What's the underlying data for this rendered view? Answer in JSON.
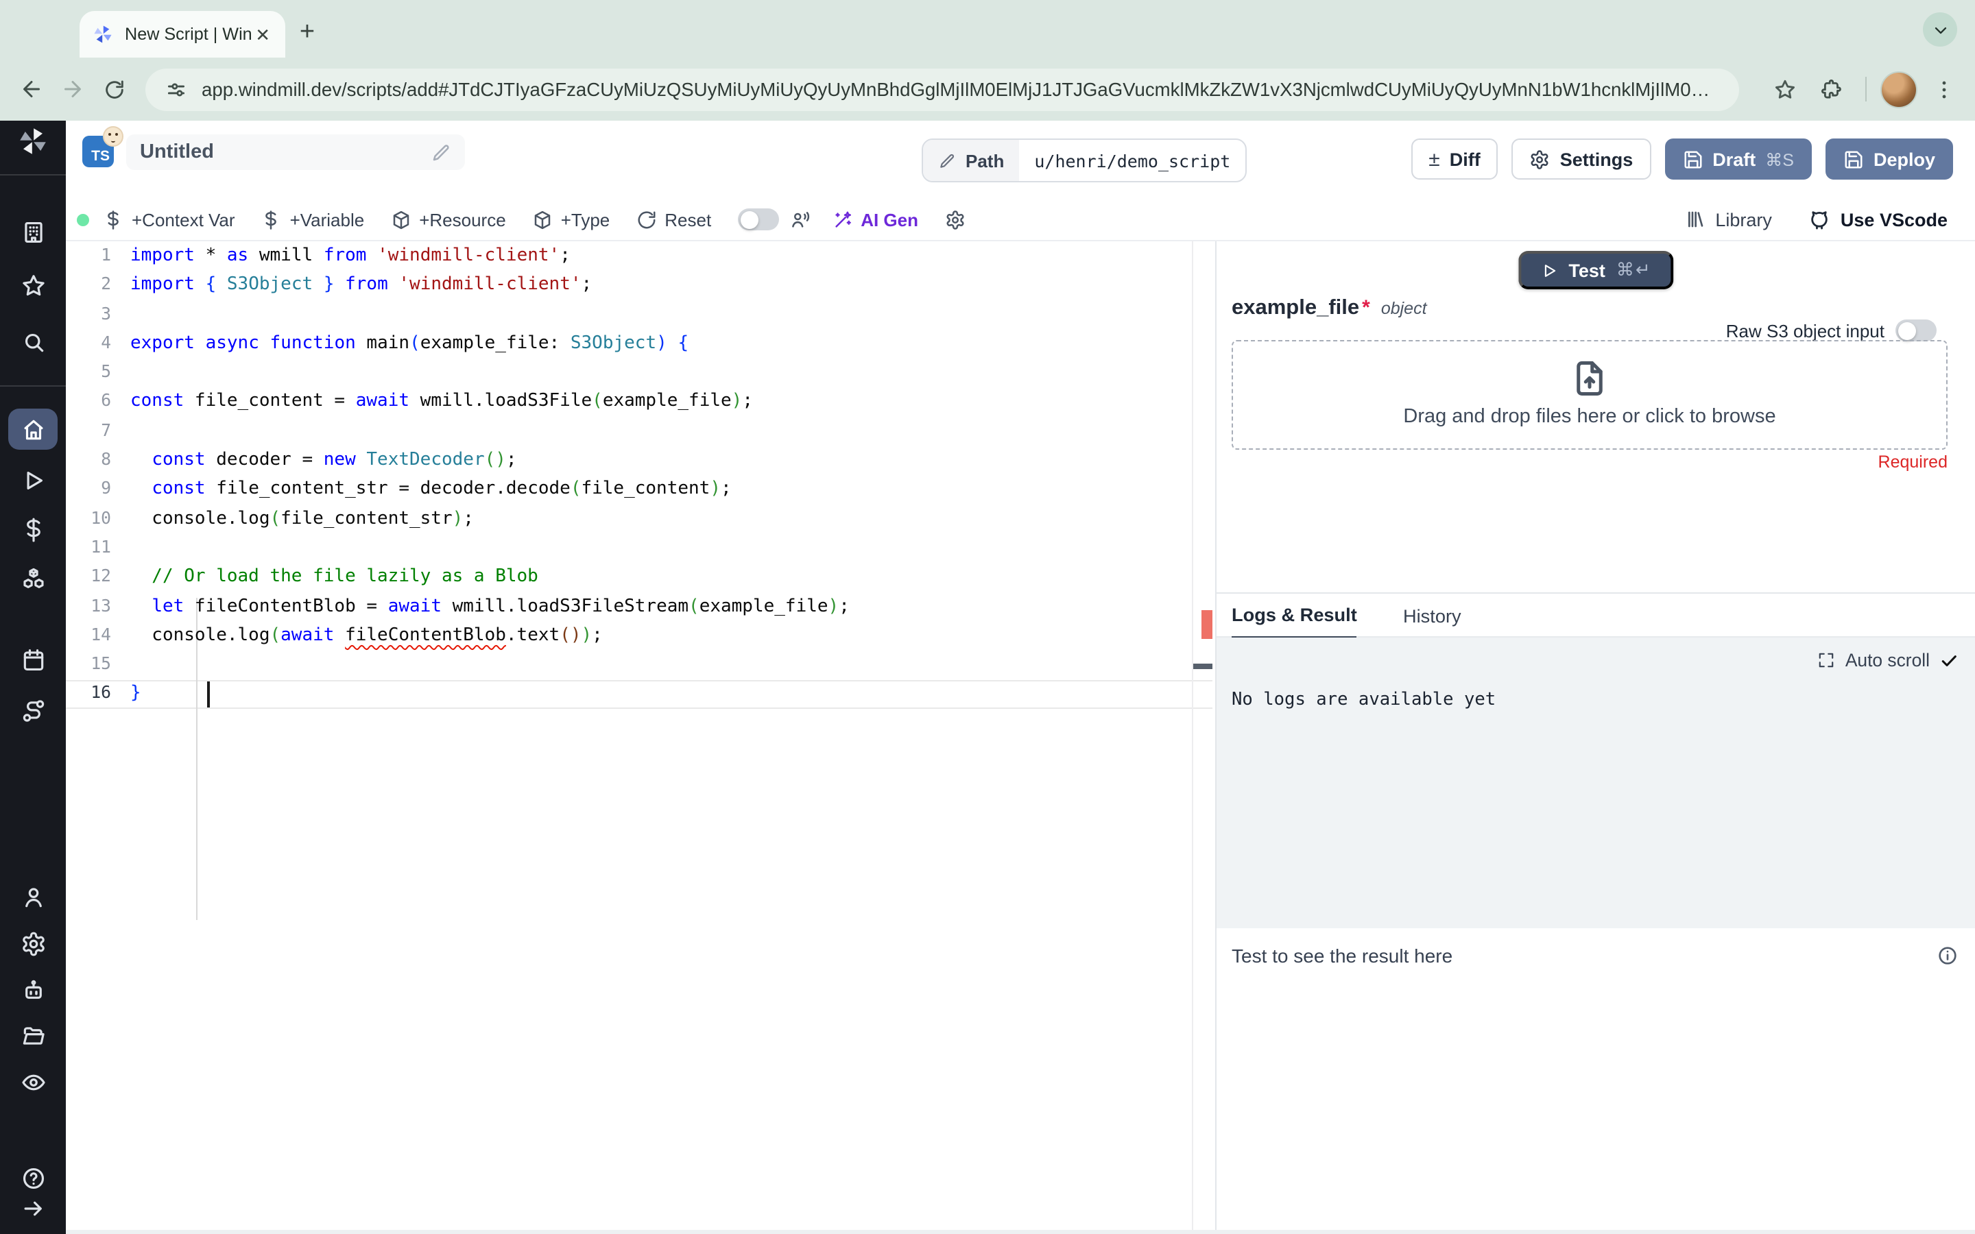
{
  "browser": {
    "tab_title": "New Script | Windmill",
    "url": "app.windmill.dev/scripts/add#JTdCJTIyaGFzaCUyMiUzQSUyMiUyMiUyQyUyMnBhdGglMjIlM0ElMjJ1JTJGaGVucmklMkZkZW1vX3NjcmlwdCUyMiUyQyUyMnN1bW1hcnklMjIlM0ElMjIlMjIlMkMlMjJjb250ZW50JTIyJTNBJTIy"
  },
  "header": {
    "language_badge": "TS",
    "title": "Untitled",
    "path_label": "Path",
    "path_value": "u/henri/demo_script",
    "diff_label": "Diff",
    "diff_symbol": "±",
    "settings_label": "Settings",
    "draft_label": "Draft",
    "draft_shortcut": "⌘S",
    "deploy_label": "Deploy"
  },
  "toolbar": {
    "items": [
      {
        "icon": "dollar",
        "label": "+Context Var"
      },
      {
        "icon": "dollar",
        "label": "+Variable"
      },
      {
        "icon": "package",
        "label": "+Resource"
      },
      {
        "icon": "package",
        "label": "+Type"
      },
      {
        "icon": "refresh",
        "label": "Reset"
      }
    ],
    "ai_gen_label": "AI Gen",
    "library_label": "Library",
    "vscode_label": "Use VScode"
  },
  "sidebar": {
    "sections": [
      {
        "items": [
          {
            "icon": "building"
          },
          {
            "icon": "star"
          },
          {
            "icon": "search"
          }
        ]
      },
      {
        "items": [
          {
            "icon": "home",
            "active": true
          },
          {
            "icon": "play"
          },
          {
            "icon": "dollar"
          },
          {
            "icon": "boxes"
          }
        ]
      },
      {
        "items": [
          {
            "icon": "calendar"
          },
          {
            "icon": "route"
          }
        ]
      }
    ],
    "bottom_items": [
      {
        "icon": "user"
      },
      {
        "icon": "gear"
      },
      {
        "icon": "robot"
      },
      {
        "icon": "folder-open"
      },
      {
        "icon": "eye"
      }
    ],
    "footer_items": [
      {
        "icon": "help"
      },
      {
        "icon": "arrow-right"
      }
    ]
  },
  "editor": {
    "active_line": 16,
    "lines": [
      [
        [
          "kw",
          "import"
        ],
        [
          "t",
          " * "
        ],
        [
          "kw",
          "as"
        ],
        [
          "t",
          " wmill "
        ],
        [
          "kw",
          "from"
        ],
        [
          "t",
          " "
        ],
        [
          "str",
          "'windmill-client'"
        ],
        [
          "t",
          ";"
        ]
      ],
      [
        [
          "kw",
          "import"
        ],
        [
          "t",
          " "
        ],
        [
          "b1",
          "{"
        ],
        [
          "t",
          " "
        ],
        [
          "type",
          "S3Object"
        ],
        [
          "t",
          " "
        ],
        [
          "b1",
          "}"
        ],
        [
          "t",
          " "
        ],
        [
          "kw",
          "from"
        ],
        [
          "t",
          " "
        ],
        [
          "str",
          "'windmill-client'"
        ],
        [
          "t",
          ";"
        ]
      ],
      [],
      [
        [
          "kw",
          "export"
        ],
        [
          "t",
          " "
        ],
        [
          "kw",
          "async"
        ],
        [
          "t",
          " "
        ],
        [
          "kw",
          "function"
        ],
        [
          "t",
          " main"
        ],
        [
          "b1",
          "("
        ],
        [
          "t",
          "example_file: "
        ],
        [
          "type",
          "S3Object"
        ],
        [
          "b1",
          ")"
        ],
        [
          "t",
          " "
        ],
        [
          "b1",
          "{"
        ]
      ],
      [],
      [
        [
          "kw",
          "const"
        ],
        [
          "t",
          " file_content = "
        ],
        [
          "kw",
          "await"
        ],
        [
          "t",
          " wmill.loadS3File"
        ],
        [
          "b2",
          "("
        ],
        [
          "t",
          "example_file"
        ],
        [
          "b2",
          ")"
        ],
        [
          "t",
          ";"
        ]
      ],
      [],
      [
        [
          "t",
          "  "
        ],
        [
          "kw",
          "const"
        ],
        [
          "t",
          " decoder = "
        ],
        [
          "kw",
          "new"
        ],
        [
          "t",
          " "
        ],
        [
          "type",
          "TextDecoder"
        ],
        [
          "b2",
          "()"
        ],
        [
          "t",
          ";"
        ]
      ],
      [
        [
          "t",
          "  "
        ],
        [
          "kw",
          "const"
        ],
        [
          "t",
          " file_content_str = decoder.decode"
        ],
        [
          "b2",
          "("
        ],
        [
          "t",
          "file_content"
        ],
        [
          "b2",
          ")"
        ],
        [
          "t",
          ";"
        ]
      ],
      [
        [
          "t",
          "  console.log"
        ],
        [
          "b2",
          "("
        ],
        [
          "t",
          "file_content_str"
        ],
        [
          "b2",
          ")"
        ],
        [
          "t",
          ";"
        ]
      ],
      [],
      [
        [
          "cmt",
          "  // Or load the file lazily as a Blob"
        ]
      ],
      [
        [
          "t",
          "  "
        ],
        [
          "kw",
          "let"
        ],
        [
          "t",
          " fileContentBlob = "
        ],
        [
          "kw",
          "await"
        ],
        [
          "t",
          " wmill.loadS3FileStream"
        ],
        [
          "b2",
          "("
        ],
        [
          "t",
          "example_file"
        ],
        [
          "b2",
          ")"
        ],
        [
          "t",
          ";"
        ]
      ],
      [
        [
          "t",
          "  console.log"
        ],
        [
          "b2",
          "("
        ],
        [
          "kw",
          "await"
        ],
        [
          "t",
          " "
        ],
        [
          "err",
          "fileContentBlob"
        ],
        [
          "t",
          ".text"
        ],
        [
          "b3",
          "()"
        ],
        [
          "b2",
          ")"
        ],
        [
          "t",
          ";"
        ]
      ],
      [],
      [
        [
          "b1",
          "}"
        ]
      ]
    ]
  },
  "panel": {
    "test_label": "Test",
    "test_shortcut": "⌘↵",
    "arg_name": "example_file",
    "arg_required_mark": "*",
    "arg_type": "object",
    "raw_s3_label": "Raw S3 object input",
    "dropzone_text": "Drag and drop files here or click to browse",
    "required_label": "Required",
    "tabs": [
      "Logs & Result",
      "History"
    ],
    "auto_scroll_label": "Auto scroll",
    "no_logs_text": "No logs are available yet",
    "result_placeholder": "Test to see the result here"
  },
  "colors": {
    "chrome_bg": "#dbe7e1",
    "sidebar_bg": "#17191f",
    "sidebar_active": "#4a5878",
    "primary_button": "#62789f",
    "test_button": "#3d4c66",
    "ai_gen": "#6d28d9",
    "status_dot": "#6ee7a7",
    "required_red": "#dc2626",
    "error_squiggle": "#e51400",
    "ts_badge": "#3178c6",
    "code_keyword": "#0000ff",
    "code_string": "#a31515",
    "code_type": "#267f99",
    "code_comment": "#008000"
  }
}
